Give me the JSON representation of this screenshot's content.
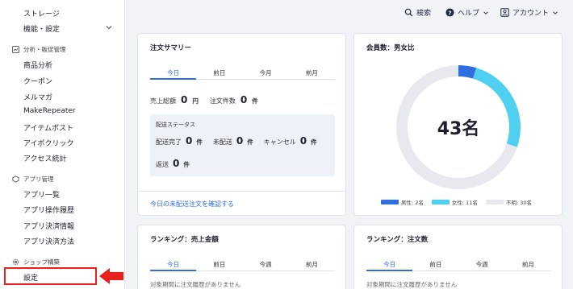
{
  "sidebar": {
    "storage": "ストレージ",
    "functions": "機能・設定",
    "analytics_head": "分析・販促管理",
    "analytics_items": [
      "商品分析",
      "クーポン",
      "メルマガ",
      "MakeRepeater",
      "アイテムポスト",
      "アイポクリック",
      "アクセス統計"
    ],
    "app_head": "アプリ管理",
    "app_items": [
      "アプリ一覧",
      "アプリ操作履歴",
      "アプリ決済情報",
      "アプリ決済方法"
    ],
    "shop_head": "ショップ構築",
    "settings": "設定"
  },
  "topbar": {
    "search": "検索",
    "help": "ヘルプ",
    "account": "アカウント"
  },
  "order_summary": {
    "title": "注文サマリー",
    "tabs": [
      "今日",
      "前日",
      "今月",
      "前月"
    ],
    "sales_label": "売上総額",
    "sales_value": "0",
    "sales_unit": "円",
    "count_label": "注文件数",
    "count_value": "0",
    "count_unit": "件",
    "shipping_status": "配送ステータス",
    "ship_done_label": "配送完了",
    "ship_done_value": "0",
    "unshipped_label": "未配送",
    "unshipped_value": "0",
    "cancel_label": "キャンセル",
    "cancel_value": "0",
    "return_label": "返送",
    "return_value": "0",
    "unit": "件",
    "link": "今日の未配送注文を確認する"
  },
  "members": {
    "title": "会員数：男女比",
    "total": "43名",
    "legend": [
      {
        "label": "男性: 2名",
        "value": 2,
        "color": "#2f6fe0"
      },
      {
        "label": "女性: 11名",
        "value": 11,
        "color": "#4fd0f0"
      },
      {
        "label": "不明: 30名",
        "value": 30,
        "color": "#e8e9ee"
      }
    ]
  },
  "ranking_sales": {
    "title": "ランキング：売上金額",
    "tabs": [
      "今日",
      "前日",
      "今週",
      "前月"
    ],
    "empty": "対象期間に注文履歴がありません"
  },
  "ranking_orders": {
    "title": "ランキング：注文数",
    "tabs": [
      "今日",
      "前日",
      "今週",
      "前月"
    ],
    "empty": "対象期間に注文履歴がありません"
  }
}
